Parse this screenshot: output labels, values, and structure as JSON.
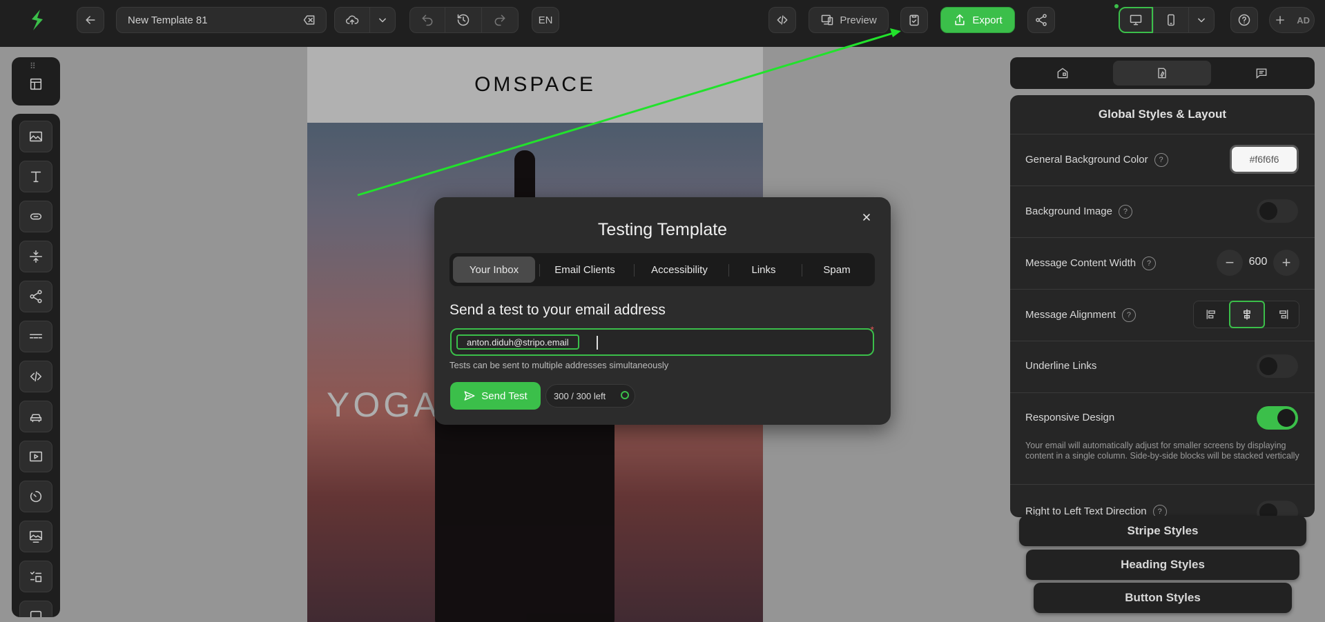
{
  "topbar": {
    "template_name": "New Template 81",
    "language": "EN",
    "preview_label": "Preview",
    "export_label": "Export",
    "user_initials": "AD"
  },
  "email_preview": {
    "brand": "OMSPACE",
    "hero_text": "YOGA"
  },
  "modal": {
    "title": "Testing Template",
    "tabs": [
      "Your Inbox",
      "Email Clients",
      "Accessibility",
      "Links",
      "Spam"
    ],
    "active_tab": "Your Inbox",
    "heading": "Send a test to your email address",
    "email_chip": "anton.diduh@stripo.email",
    "hint": "Tests can be sent to multiple addresses simultaneously",
    "send_label": "Send Test",
    "quota": "300 / 300 left",
    "required_mark": "*"
  },
  "right_panel": {
    "title": "Global Styles & Layout",
    "bg_color_label": "General Background Color",
    "bg_color_value": "#f6f6f6",
    "bg_image_label": "Background Image",
    "content_width_label": "Message Content Width",
    "content_width_value": "600",
    "alignment_label": "Message Alignment",
    "alignment_value": "center",
    "underline_label": "Underline Links",
    "underline_on": false,
    "responsive_label": "Responsive Design",
    "responsive_on": true,
    "responsive_desc": "Your email will automatically adjust for smaller screens by displaying content in a single column. Side-by-side blocks will be stacked vertically",
    "rtl_label": "Right to Left Text Direction",
    "stripe_styles": "Stripe Styles",
    "heading_styles": "Heading Styles",
    "button_styles": "Button Styles"
  },
  "colors": {
    "accent": "#3bbf4a",
    "panel": "#262626",
    "topbar": "#1f1f1f"
  },
  "icons": [
    "logo-icon",
    "back-icon",
    "clear-icon",
    "upload-icon",
    "chevron-down-icon",
    "undo-icon",
    "history-icon",
    "redo-icon",
    "code-icon",
    "preview-icon",
    "test-icon",
    "export-icon",
    "share-icon",
    "desktop-icon",
    "mobile-icon",
    "help-icon",
    "plus-icon"
  ]
}
